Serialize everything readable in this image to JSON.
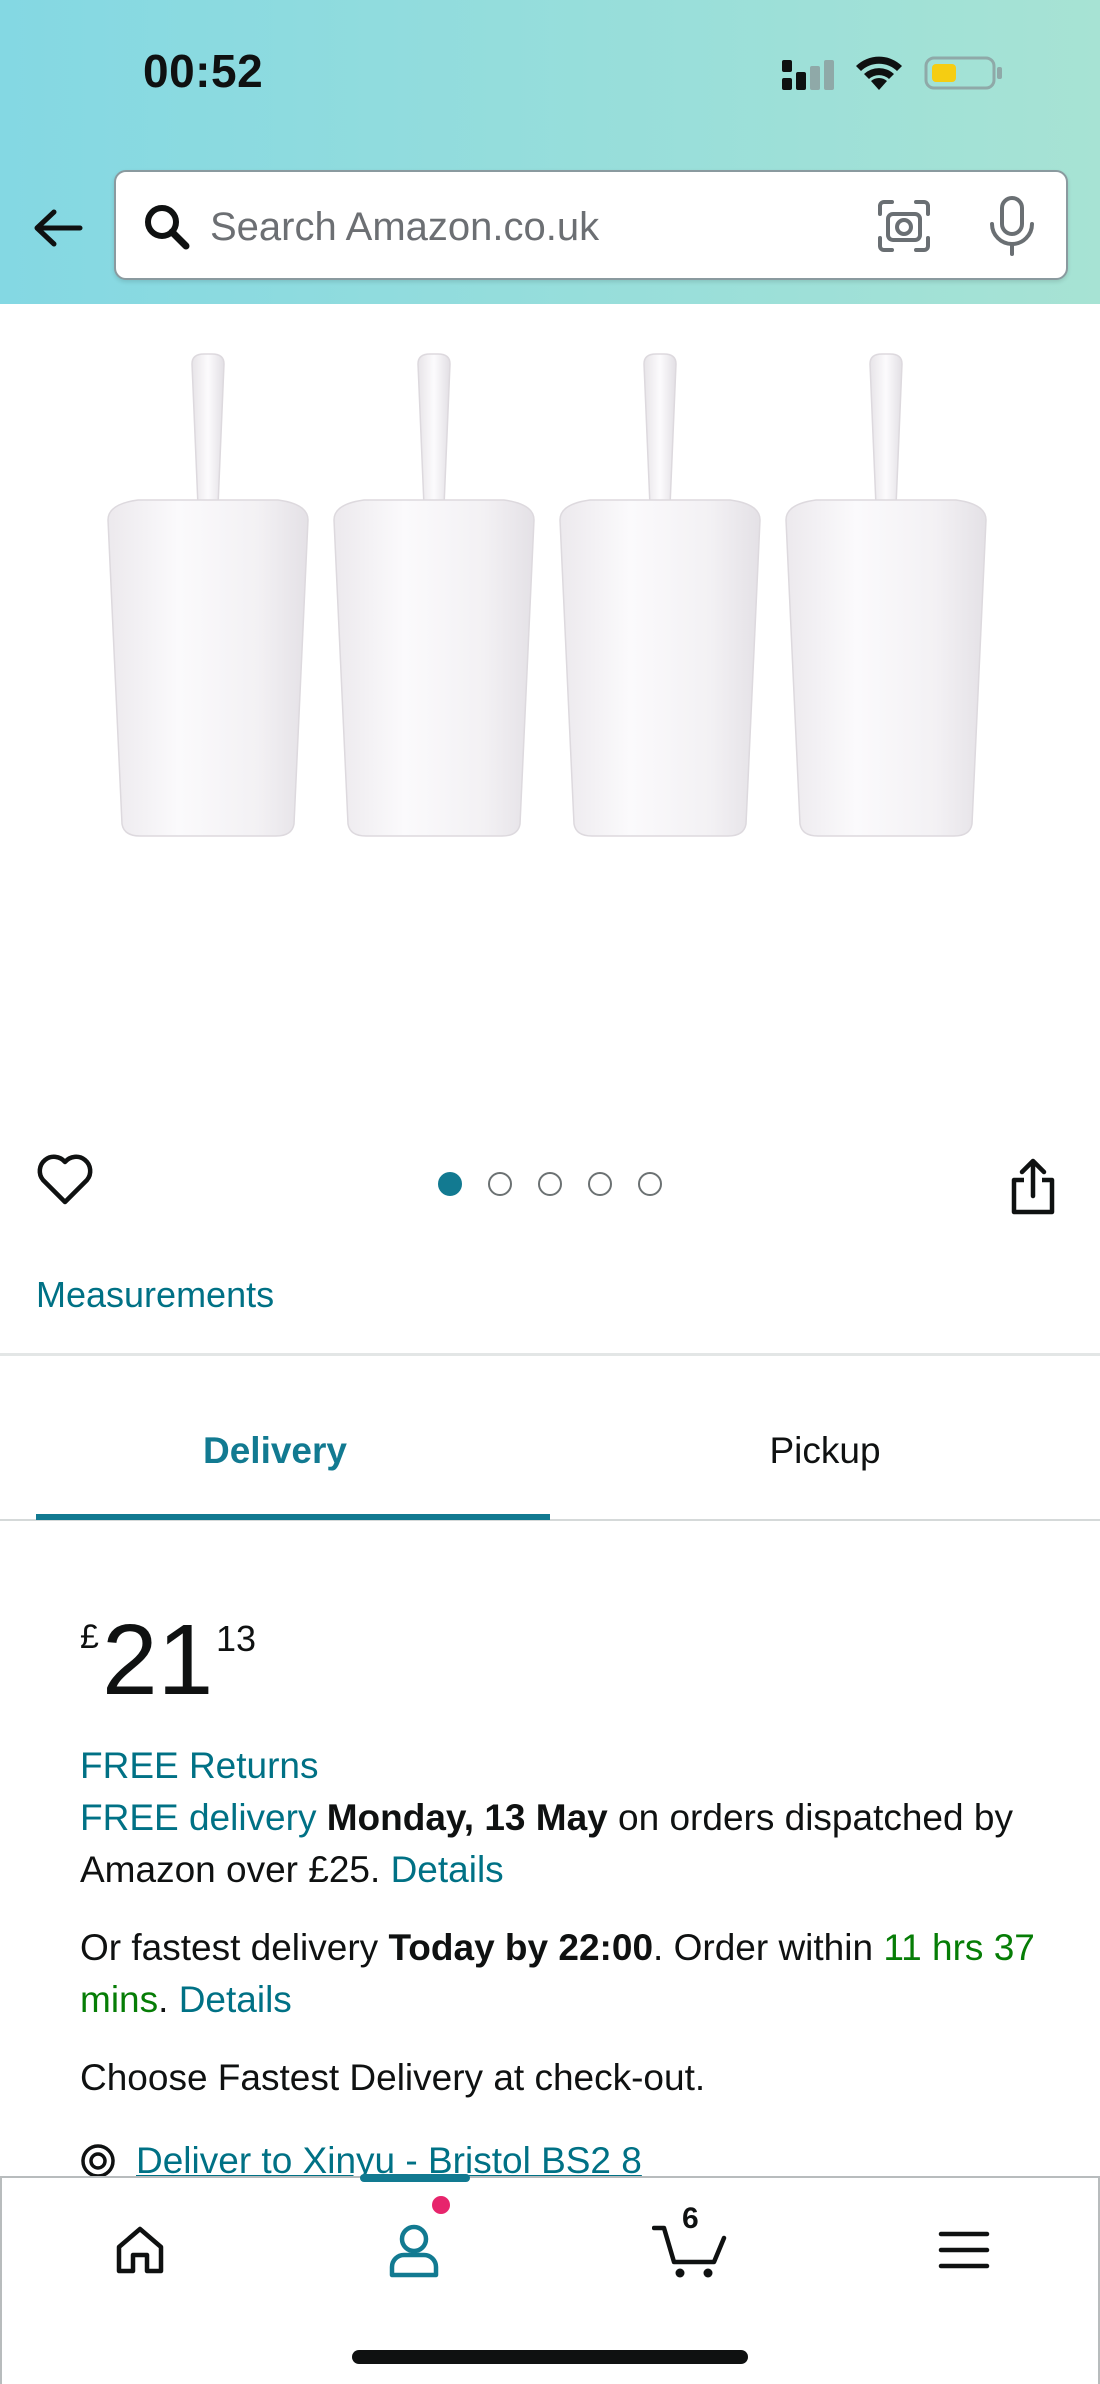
{
  "status_bar": {
    "time": "00:52"
  },
  "search": {
    "placeholder": "Search Amazon.co.uk"
  },
  "icons": {
    "back": "arrow-left-icon",
    "search": "magnifier-icon",
    "camera": "camera-scan-icon",
    "mic": "microphone-icon",
    "wishlist": "heart-icon",
    "share": "share-icon",
    "location": "location-target-icon",
    "home": "home-icon",
    "account": "account-icon",
    "cart": "cart-icon",
    "menu": "hamburger-menu-icon"
  },
  "carousel": {
    "total_images": 5,
    "active_index": 0
  },
  "product": {
    "measurements_link": "Measurements"
  },
  "tabs": [
    {
      "label": "Delivery",
      "active": true
    },
    {
      "label": "Pickup",
      "active": false
    }
  ],
  "price": {
    "currency": "£",
    "whole": "21",
    "fraction": "13"
  },
  "delivery": {
    "free_returns": "FREE Returns",
    "free_delivery": "FREE delivery",
    "delivery_date": "Monday, 13 May",
    "delivery_rest": " on orders dispatched by Amazon over £25. ",
    "details_1": "Details",
    "fastest_prefix": "Or fastest delivery ",
    "fastest_time": "Today by 22:00",
    "order_within": ". Order within ",
    "countdown": "11 hrs 37 mins",
    "period": ".",
    "details_2": "Details",
    "choose_fastest": "Choose Fastest Delivery at check-out.",
    "deliver_to": "Deliver to Xinyu - Bristol BS2 8"
  },
  "bottom_nav": {
    "cart_count": "6"
  },
  "colors": {
    "accent": "#127a91",
    "link": "#007185",
    "green": "#067d06",
    "badge": "#e7256c",
    "header_gradient_start": "#84d8e3",
    "header_gradient_end": "#a7e3d4"
  }
}
